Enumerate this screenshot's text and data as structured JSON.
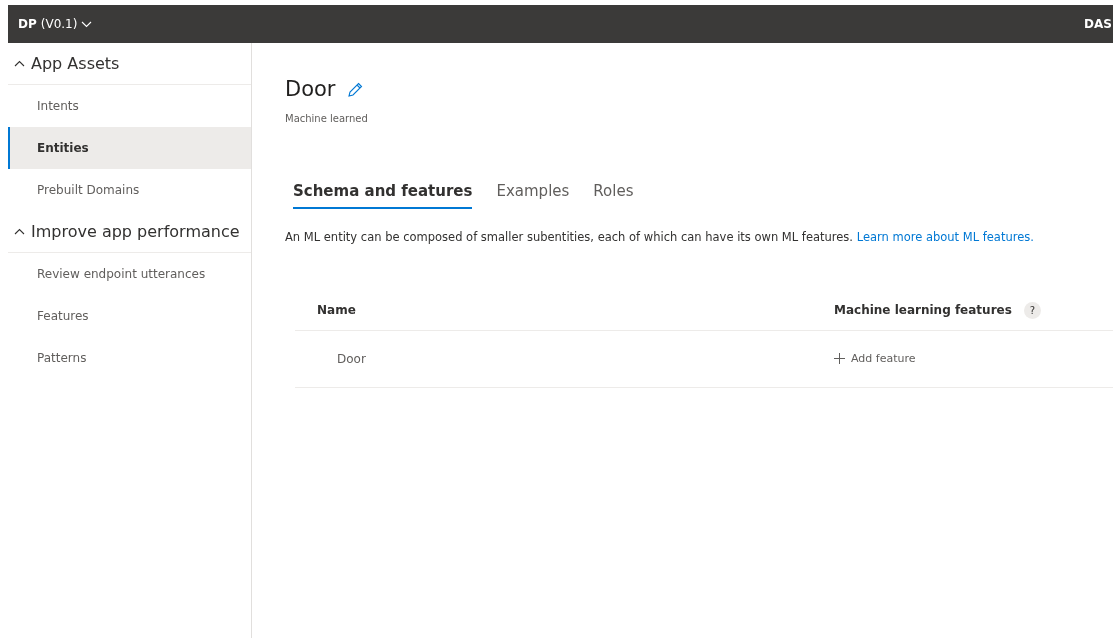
{
  "top_bar": {
    "app_name": "DP (V0.1)",
    "right_text": "DAS"
  },
  "sidebar": {
    "groups": [
      {
        "title": "App Assets",
        "expanded": true,
        "items": [
          {
            "label": "Intents",
            "selected": false
          },
          {
            "label": "Entities",
            "selected": true
          },
          {
            "label": "Prebuilt Domains",
            "selected": false
          }
        ]
      },
      {
        "title": "Improve app performance",
        "expanded": true,
        "items": [
          {
            "label": "Review endpoint utterances",
            "selected": false
          },
          {
            "label": "Features",
            "selected": false
          },
          {
            "label": "Patterns",
            "selected": false
          }
        ]
      }
    ]
  },
  "entity": {
    "title": "Door",
    "subtitle": "Machine learned"
  },
  "tabs": [
    {
      "label": "Schema and features",
      "selected": true
    },
    {
      "label": "Examples",
      "selected": false
    },
    {
      "label": "Roles",
      "selected": false
    }
  ],
  "description": {
    "text": "An ML entity can be composed of smaller subentities, each of which can have its own ML features.",
    "link": "Learn more about ML features."
  },
  "table": {
    "columns": [
      {
        "label": "Name"
      },
      {
        "label": "Machine learning features",
        "help": "?"
      }
    ],
    "rows": [
      {
        "name": "Door",
        "action": "Add feature"
      }
    ]
  }
}
